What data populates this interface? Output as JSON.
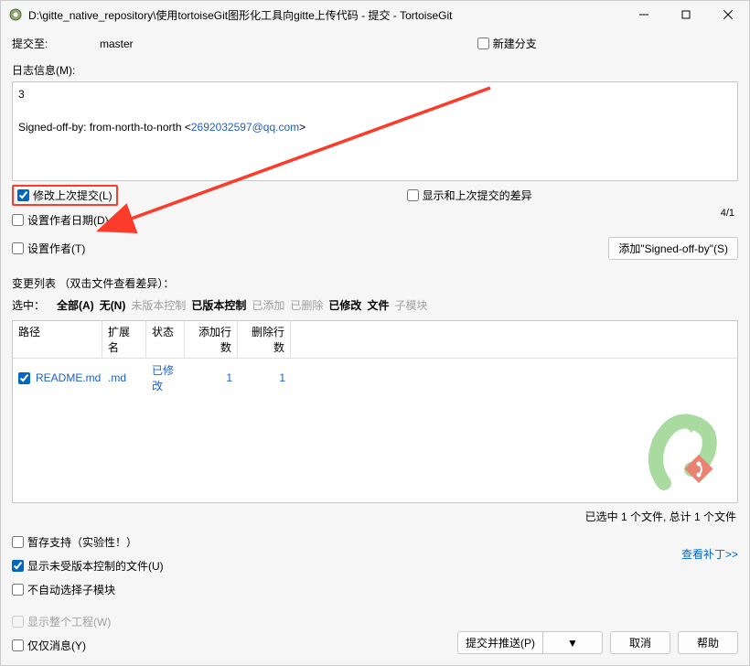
{
  "window": {
    "title": "D:\\gitte_native_repository\\使用tortoiseGit图形化工具向gitte上传代码 - 提交 - TortoiseGit"
  },
  "commit_to": {
    "label": "提交至:",
    "branch": "master",
    "new_branch_label": "新建分支"
  },
  "log": {
    "label": "日志信息(M):",
    "msg_line1": "3",
    "msg_line3_prefix": "Signed-off-by: from-north-to-north <",
    "msg_email": "2692032597@qq.com",
    "msg_line3_suffix": ">",
    "counter": "4/1"
  },
  "options": {
    "amend_last": "修改上次提交(L)",
    "show_diff_last": "显示和上次提交的差异",
    "set_author_date": "设置作者日期(D)",
    "set_author": "设置作者(T)",
    "add_signed_off": "添加\"Signed-off-by\"(S)"
  },
  "changes": {
    "label": "变更列表 （双击文件查看差异）：",
    "filter_label": "选中：",
    "filter_all": "全部(A)",
    "filter_none": "无(N)",
    "filter_unversioned": "未版本控制",
    "filter_versioned": "已版本控制",
    "filter_added": "已添加",
    "filter_deleted": "已删除",
    "filter_modified": "已修改",
    "filter_file": "文件",
    "filter_submod": "子模块"
  },
  "table": {
    "headers": {
      "path": "路径",
      "ext": "扩展名",
      "status": "状态",
      "added": "添加行数",
      "deleted": "删除行数"
    },
    "rows": [
      {
        "checked": true,
        "name": "README.md",
        "ext": ".md",
        "status": "已修改",
        "added": "1",
        "deleted": "1"
      }
    ]
  },
  "status": {
    "selected": "已选中 1 个文件, 总计 1 个文件",
    "stash": "暂存支持（实验性！）",
    "show_unversioned": "显示未受版本控制的文件(U)",
    "no_auto_submod": "不自动选择子模块",
    "view_patch": "查看补丁>>"
  },
  "footer": {
    "show_whole_proj": "显示整个工程(W)",
    "only_msg": "仅仅消息(Y)",
    "commit_push": "提交并推送(P)",
    "cancel": "取消",
    "help": "帮助"
  }
}
